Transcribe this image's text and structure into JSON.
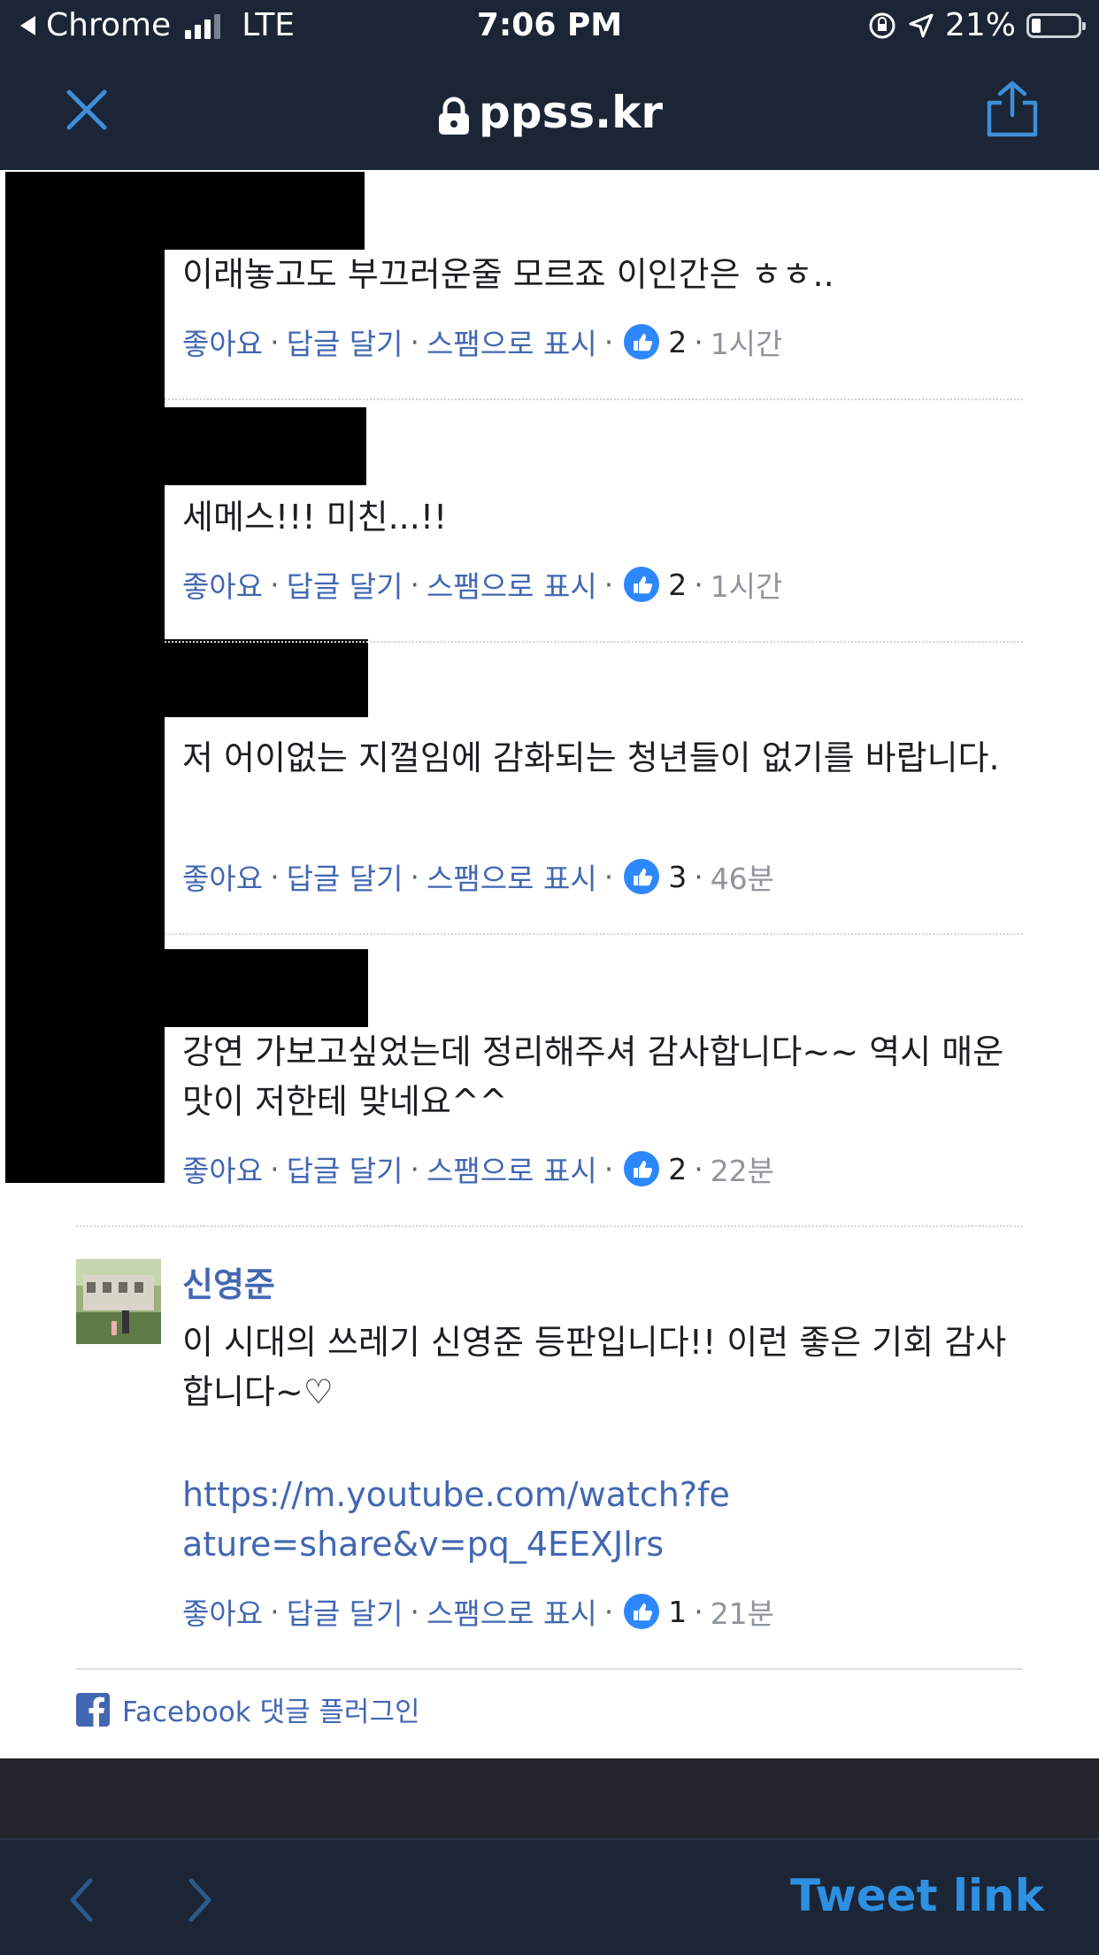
{
  "status_bar": {
    "back_app": "Chrome",
    "network": "LTE",
    "time": "7:06 PM",
    "battery": "21%"
  },
  "nav": {
    "domain": "ppss.kr"
  },
  "comments": [
    {
      "text": "이래놓고도 부끄러운줄 모르죠 이인간은 ㅎㅎ..",
      "like": "좋아요",
      "reply": "답글 달기",
      "spam": "스팸으로 표시",
      "likes": "2",
      "time": "1시간"
    },
    {
      "text": "세메스!!! 미친...!!",
      "like": "좋아요",
      "reply": "답글 달기",
      "spam": "스팸으로 표시",
      "likes": "2",
      "time": "1시간"
    },
    {
      "text": "저 어이없는 지껄임에 감화되는 청년들이 없기를 바랍니다.",
      "like": "좋아요",
      "reply": "답글 달기",
      "spam": "스팸으로 표시",
      "likes": "3",
      "time": "46분"
    },
    {
      "text": "강연 가보고싶었는데 정리해주셔 감사합니다~~ 역시 매운맛이 저한테 맞네요^^",
      "like": "좋아요",
      "reply": "답글 달기",
      "spam": "스팸으로 표시",
      "likes": "2",
      "time": "22분"
    }
  ],
  "featured_comment": {
    "author": "신영준",
    "text": "이 시대의 쓰레기 신영준 등판입니다!! 이런 좋은 기회 감사합니다~♡",
    "link": "https://m.youtube.com/watch?feature=share&v=pq_4EEXJlrs",
    "like": "좋아요",
    "reply": "답글 달기",
    "spam": "스팸으로 표시",
    "likes": "1",
    "time": "21분"
  },
  "plugin_label": "Facebook 댓글 플러그인",
  "toolbar": {
    "tweet_link": "Tweet link"
  },
  "colors": {
    "chrome_bg": "#1b2536",
    "link_blue": "#4267b2",
    "tweet_blue": "#2e90e0",
    "like_badge": "#2d88ff"
  }
}
